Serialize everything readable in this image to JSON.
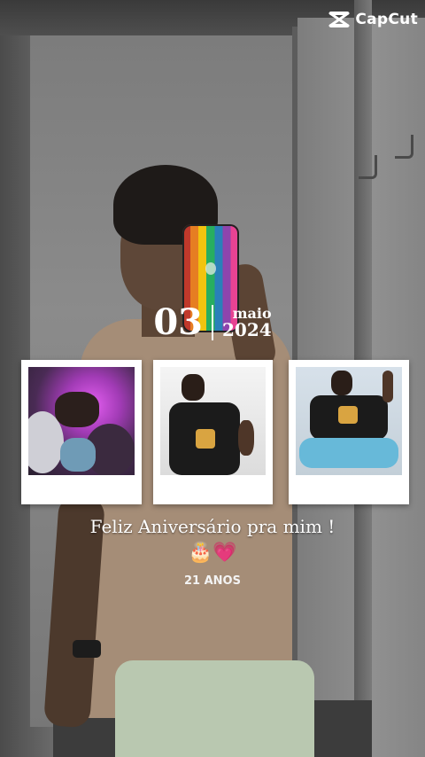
{
  "watermark": {
    "brand": "CapCut",
    "icon": "capcut-logo-icon"
  },
  "date": {
    "day": "03",
    "month": "maio",
    "year": "2024"
  },
  "photos": [
    {
      "icon": "photo-balloons-purple-light"
    },
    {
      "icon": "photo-person-black-tshirt"
    },
    {
      "icon": "photo-person-sitting-sparkler"
    }
  ],
  "caption": {
    "text": "Feliz Aniversário pra mim !",
    "emojis": "🎂💗",
    "age": "21 ANOS"
  },
  "colors": {
    "text": "#ffffff",
    "polaroid": "#ffffff"
  }
}
